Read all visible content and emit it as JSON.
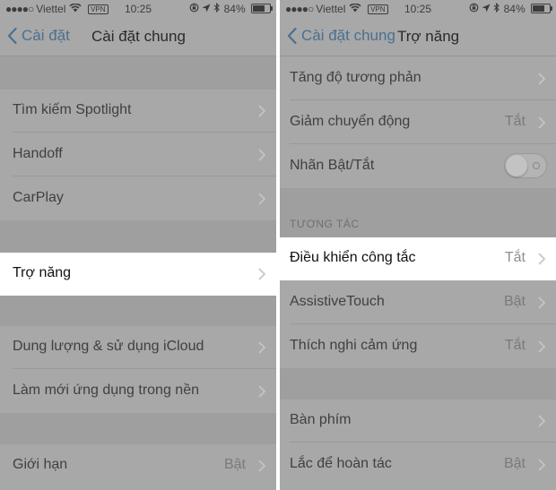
{
  "status_bar": {
    "carrier": "Viettel",
    "vpn": "VPN",
    "time": "10:25",
    "battery": "84%",
    "battery_level": 0.84
  },
  "left": {
    "back_label": "Cài đặt",
    "title": "Cài đặt chung",
    "rows": [
      {
        "label": "Tìm kiếm Spotlight",
        "value": ""
      },
      {
        "label": "Handoff",
        "value": ""
      },
      {
        "label": "CarPlay",
        "value": ""
      },
      {
        "label": "Trợ năng",
        "value": ""
      },
      {
        "label": "Dung lượng & sử dụng iCloud",
        "value": ""
      },
      {
        "label": "Làm mới ứng dụng trong nền",
        "value": ""
      },
      {
        "label": "Giới hạn",
        "value": "Bật"
      }
    ]
  },
  "right": {
    "back_label": "Cài đặt chung",
    "title": "Trợ năng",
    "section_header": "TƯƠNG TÁC",
    "rows": [
      {
        "label": "Tăng độ tương phản",
        "value": ""
      },
      {
        "label": "Giảm chuyển động",
        "value": "Tắt"
      },
      {
        "label": "Nhãn Bật/Tắt",
        "value": ""
      },
      {
        "label": "Điều khiển công tắc",
        "value": "Tắt"
      },
      {
        "label": "AssistiveTouch",
        "value": "Bật"
      },
      {
        "label": "Thích nghi cảm ứng",
        "value": "Tắt"
      },
      {
        "label": "Bàn phím",
        "value": ""
      },
      {
        "label": "Lắc để hoàn tác",
        "value": "Bật"
      }
    ]
  }
}
